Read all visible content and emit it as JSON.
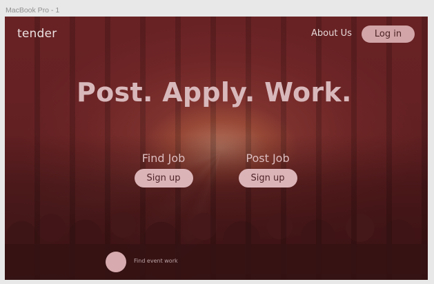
{
  "frame": {
    "label": "MacBook Pro - 1"
  },
  "header": {
    "logo": "tender",
    "nav": {
      "about": "About Us"
    },
    "login_button": "Log in"
  },
  "hero": {
    "headline": "Post. Apply. Work.",
    "find_job": {
      "title": "Find Job",
      "button": "Sign up"
    },
    "post_job": {
      "title": "Post Job",
      "button": "Sign up"
    }
  },
  "footer": {
    "tagline": "Find event work"
  },
  "colors": {
    "background_overlay": "#682326",
    "button_fill": "#d2a5a8",
    "headline": "#d8b8bb"
  },
  "icons": {
    "footer_avatar": "circle-icon"
  }
}
